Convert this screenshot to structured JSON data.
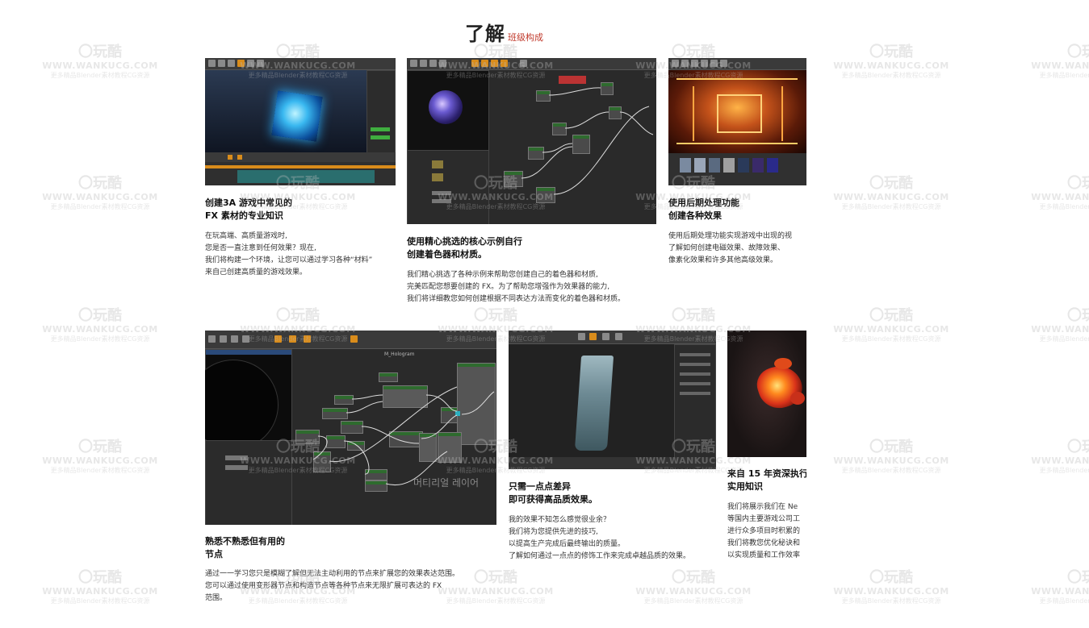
{
  "header": {
    "title_main": "了解",
    "title_sub": "班级构成"
  },
  "cards": [
    {
      "thumb_name": "ue-cube-material-preview",
      "heading_lines": [
        "创建3A 游戏中常见的",
        "FX 素材的专业知识"
      ],
      "body_lines": [
        "在玩高端、高质量游戏时,",
        "您是否一直注意到任何效果？现在,",
        "我们将构建一个环境，让您可以通过学习各种“材料”",
        "来自己创建高质量的游戏效果。"
      ]
    },
    {
      "thumb_name": "ue-shader-graph-sphere",
      "heading_lines": [
        "使用精心挑选的核心示例自行",
        "创建着色器和材质。"
      ],
      "body_lines": [
        "我们精心挑选了各种示例来帮助您创建自己的着色器和材质,",
        "完美匹配您想要创建的 FX。为了帮助您增强作为效果器的能力,",
        "我们将详细教您如何创建根据不同表达方法而变化的着色器和材质。"
      ]
    },
    {
      "thumb_name": "ue-sci-fi-corridor-postprocess",
      "heading_lines": [
        "使用后期处理功能",
        "创建各种效果"
      ],
      "body_lines": [
        "使用后期处理功能实现游戏中出现的视",
        "了解如何创建电磁效果、故障效果、",
        "像素化效果和许多其他高级效果。"
      ]
    },
    {
      "thumb_name": "ue-material-node-editor",
      "heading_lines": [
        "熟悉不熟悉但有用的",
        "节点"
      ],
      "body_lines": [
        "通过一一学习您只是模糊了解但无法主动利用的节点来扩展您的效果表达范围。",
        "您可以通过使用变形器节点和构造节点等各种节点来无限扩展可表达的 FX",
        "范围。"
      ]
    },
    {
      "thumb_name": "ue-waterfall-effect",
      "heading_lines": [
        "只需一点点差异",
        "即可获得高品质效果。"
      ],
      "body_lines": [
        "我的效果不知怎么感觉很业余？",
        "我们将为您提供先进的技巧,",
        "以提高生产完成后最终输出的质量。",
        "了解如何通过一点点的修饰工作来完成卓越品质的效果。"
      ]
    },
    {
      "thumb_name": "ue-fire-creature-effect",
      "heading_lines": [
        "来自 15 年资深执行",
        "实用知识"
      ],
      "body_lines": [
        "我们将展示我们在 Ne",
        "等国内主要游戏公司工",
        "进行众多项目时积累的",
        "我们将教您优化秘诀和",
        "以实现质量和工作效率"
      ]
    }
  ],
  "watermark": {
    "logo": "〇玩酷",
    "url": "WWW.WANKUCG.COM",
    "sub": "更多精品Blender素材教程CG资源"
  },
  "thumbnail_overlay_texts": {
    "graph_title": "M_Hologram",
    "korean_caption": "머티리얼 레이어"
  },
  "colors": {
    "accent": "#c0392b",
    "toolbar_orange": "#d98c1b"
  }
}
